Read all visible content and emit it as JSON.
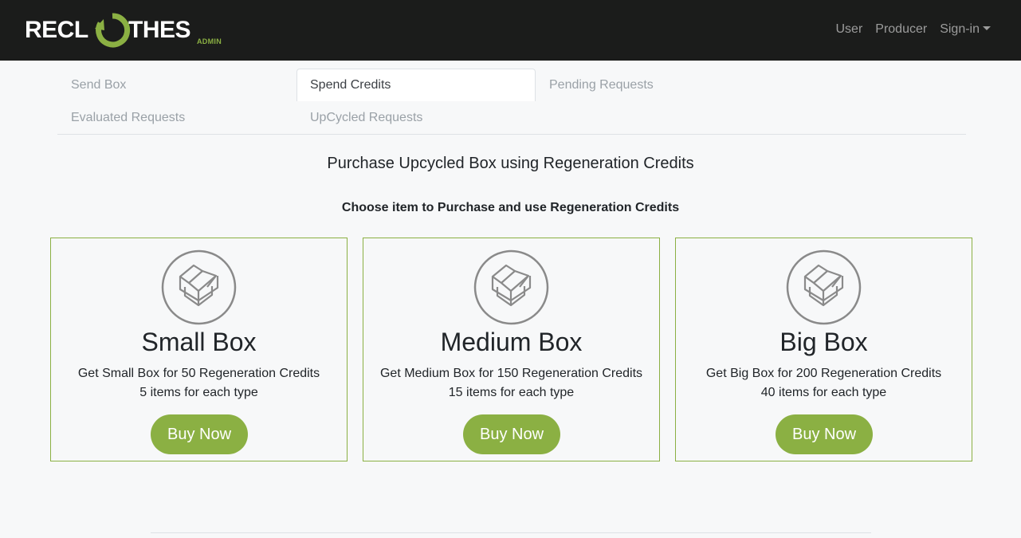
{
  "brand": {
    "left": "RECL",
    "right": "THES",
    "sub": "ADMIN",
    "accent_color": "#8bb043"
  },
  "nav": {
    "user": "User",
    "producer": "Producer",
    "signin": "Sign-in"
  },
  "tabs": [
    {
      "label": "Send Box"
    },
    {
      "label": "Spend Credits"
    },
    {
      "label": "Pending Requests"
    },
    {
      "label": "Evaluated Requests"
    },
    {
      "label": "UpCycled Requests"
    }
  ],
  "active_tab": "Spend Credits",
  "page": {
    "title": "Purchase Upcycled Box using Regeneration Credits",
    "subtitle": "Choose item to Purchase and use Regeneration Credits"
  },
  "cards": [
    {
      "icon": "open-box-icon",
      "title": "Small Box",
      "desc": "Get Small Box for 50 Regeneration Credits",
      "items": "5 items for each type",
      "button": "Buy Now"
    },
    {
      "icon": "open-box-icon",
      "title": "Medium Box",
      "desc": "Get Medium Box for 150 Regeneration Credits",
      "items": "15 items for each type",
      "button": "Buy Now"
    },
    {
      "icon": "open-box-icon",
      "title": "Big Box",
      "desc": "Get Big Box for 200 Regeneration Credits",
      "items": "40 items for each type",
      "button": "Buy Now"
    }
  ]
}
